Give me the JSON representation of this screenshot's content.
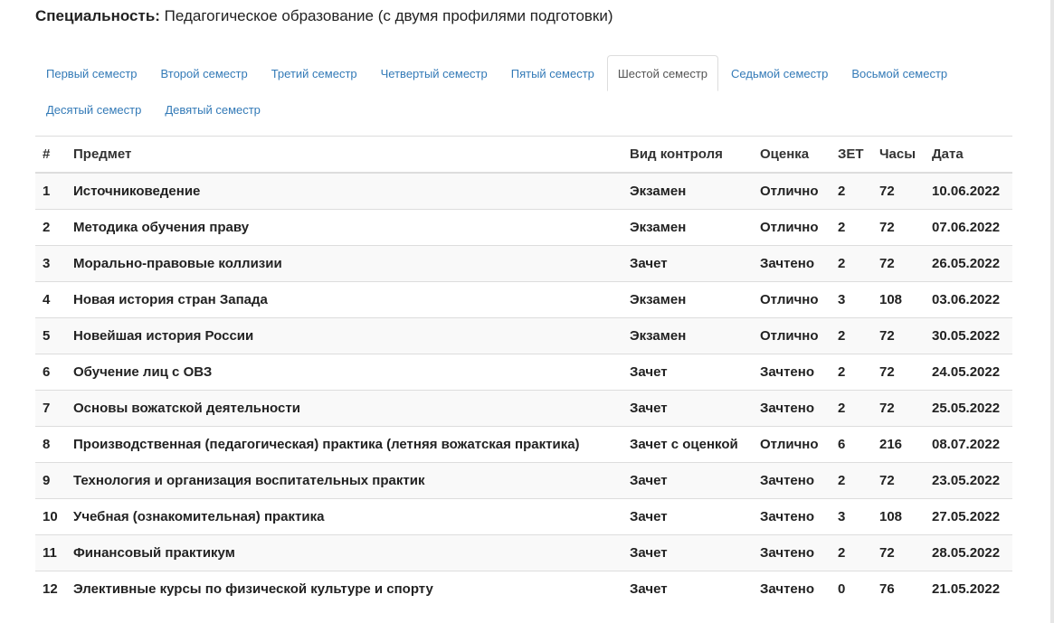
{
  "specialty": {
    "label": "Специальность:",
    "value": "Педагогическое образование (с двумя профилями подготовки)"
  },
  "tabs": [
    {
      "label": "Первый семестр",
      "active": false
    },
    {
      "label": "Второй семестр",
      "active": false
    },
    {
      "label": "Третий семестр",
      "active": false
    },
    {
      "label": "Четвертый семестр",
      "active": false
    },
    {
      "label": "Пятый семестр",
      "active": false
    },
    {
      "label": "Шестой семестр",
      "active": true
    },
    {
      "label": "Седьмой семестр",
      "active": false
    },
    {
      "label": "Восьмой семестр",
      "active": false
    },
    {
      "label": "Десятый семестр",
      "active": false
    },
    {
      "label": "Девятый семестр",
      "active": false
    }
  ],
  "table": {
    "headers": [
      "#",
      "Предмет",
      "Вид контроля",
      "Оценка",
      "ЗЕТ",
      "Часы",
      "Дата"
    ],
    "rows": [
      [
        "1",
        "Источниковедение",
        "Экзамен",
        "Отлично",
        "2",
        "72",
        "10.06.2022"
      ],
      [
        "2",
        "Методика обучения праву",
        "Экзамен",
        "Отлично",
        "2",
        "72",
        "07.06.2022"
      ],
      [
        "3",
        "Морально-правовые коллизии",
        "Зачет",
        "Зачтено",
        "2",
        "72",
        "26.05.2022"
      ],
      [
        "4",
        "Новая история стран Запада",
        "Экзамен",
        "Отлично",
        "3",
        "108",
        "03.06.2022"
      ],
      [
        "5",
        "Новейшая история России",
        "Экзамен",
        "Отлично",
        "2",
        "72",
        "30.05.2022"
      ],
      [
        "6",
        "Обучение лиц с ОВЗ",
        "Зачет",
        "Зачтено",
        "2",
        "72",
        "24.05.2022"
      ],
      [
        "7",
        "Основы вожатской деятельности",
        "Зачет",
        "Зачтено",
        "2",
        "72",
        "25.05.2022"
      ],
      [
        "8",
        "Производственная (педагогическая) практика (летняя вожатская практика)",
        "Зачет с оценкой",
        "Отлично",
        "6",
        "216",
        "08.07.2022"
      ],
      [
        "9",
        "Технология и организация воспитательных практик",
        "Зачет",
        "Зачтено",
        "2",
        "72",
        "23.05.2022"
      ],
      [
        "10",
        "Учебная (ознакомительная) практика",
        "Зачет",
        "Зачтено",
        "3",
        "108",
        "27.05.2022"
      ],
      [
        "11",
        "Финансовый практикум",
        "Зачет",
        "Зачтено",
        "2",
        "72",
        "28.05.2022"
      ],
      [
        "12",
        "Элективные курсы по физической культуре и спорту",
        "Зачет",
        "Зачтено",
        "0",
        "76",
        "21.05.2022"
      ]
    ]
  }
}
